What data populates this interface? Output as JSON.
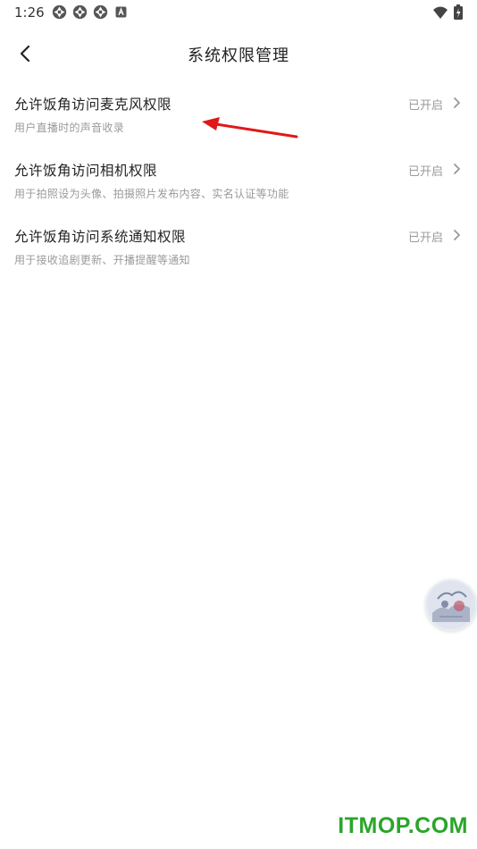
{
  "status_bar": {
    "time": "1:26",
    "left_icons": [
      "notification-icon",
      "notification-icon",
      "notification-icon",
      "app-a-icon"
    ],
    "right_icons": [
      "wifi-icon",
      "battery-charging-icon"
    ]
  },
  "header": {
    "title": "系统权限管理",
    "back_icon": "chevron-left-icon"
  },
  "permissions": [
    {
      "title": "允许饭角访问麦克风权限",
      "description": "用户直播时的声音收录",
      "status": "已开启"
    },
    {
      "title": "允许饭角访问相机权限",
      "description": "用于拍照设为头像、拍摄照片发布内容、实名认证等功能",
      "status": "已开启"
    },
    {
      "title": "允许饭角访问系统通知权限",
      "description": "用于接收追剧更新、开播提醒等通知",
      "status": "已开启"
    }
  ],
  "annotation": {
    "color": "#e01818",
    "icon": "red-arrow"
  },
  "floating_avatar": {
    "icon": "avatar-floating-button"
  },
  "watermark": {
    "text": "ITMOP.COM",
    "color": "#2aa52a"
  },
  "colors": {
    "title": "#222222",
    "secondary": "#9a9a9a",
    "background": "#ffffff"
  }
}
